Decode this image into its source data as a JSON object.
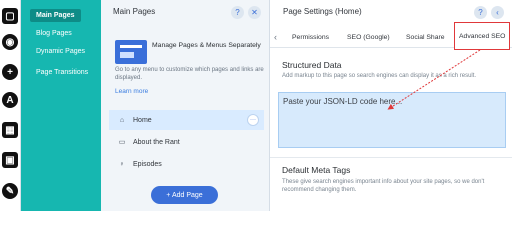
{
  "rail": {
    "icons": [
      "pages-icon",
      "add-icon",
      "design-icon",
      "apps-icon",
      "media-icon",
      "blog-icon"
    ]
  },
  "nav": {
    "items": [
      {
        "label": "Main Pages"
      },
      {
        "label": "Blog Pages"
      },
      {
        "label": "Dynamic Pages"
      },
      {
        "label": "Page Transitions"
      }
    ]
  },
  "pages_panel": {
    "title": "Main Pages",
    "help": "?",
    "close": "✕",
    "promo_title": "Manage Pages & Menus Separately",
    "promo_text": "Go to any menu to customize which pages and links are displayed.",
    "promo_link": "Learn more",
    "pages": [
      {
        "label": "Home",
        "icon": "⌂"
      },
      {
        "label": "About the Rant",
        "icon": "▭"
      },
      {
        "label": "Episodes",
        "icon": "♀"
      }
    ],
    "row_menu": "···",
    "add_page_label": "+ Add Page"
  },
  "settings_panel": {
    "title": "Page Settings (Home)",
    "help": "?",
    "back": "‹",
    "tabs": [
      {
        "label": "Permissions"
      },
      {
        "label": "SEO (Google)"
      },
      {
        "label": "Social Share"
      },
      {
        "label": "Advanced SEO"
      }
    ],
    "structured_title": "Structured Data",
    "structured_text": "Add markup to this page so search engines can display it as a rich result.",
    "json_placeholder": "Paste your JSON-LD code here...",
    "meta_title": "Default Meta Tags",
    "meta_text": "These give search engines important info about your site pages, so we don't recommend changing them."
  },
  "colors": {
    "teal": "#16b7b0",
    "accent_blue": "#3b6fd8",
    "highlight_red": "#e0383a",
    "selected_row": "#d9ebff"
  }
}
